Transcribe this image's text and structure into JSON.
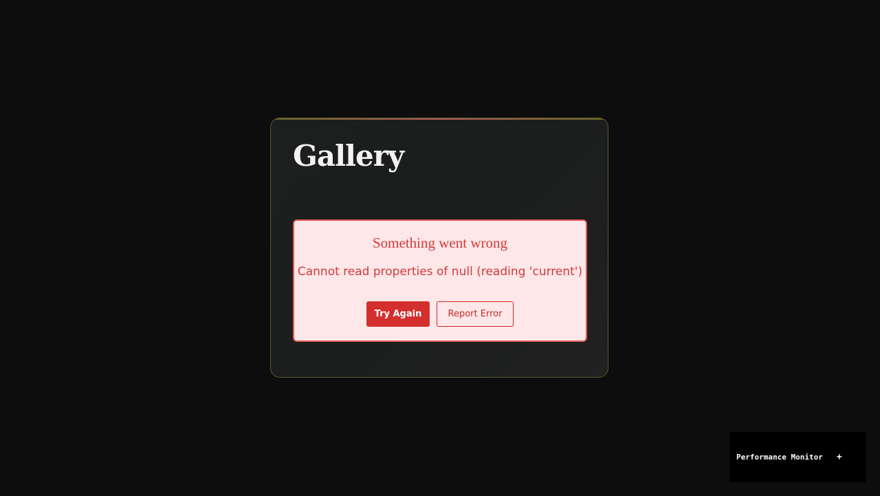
{
  "card": {
    "title": "Gallery"
  },
  "error": {
    "title": "Something went wrong",
    "message": "Cannot read properties of null (reading 'current')",
    "try_again_label": "Try Again",
    "report_label": "Report Error"
  },
  "perf_monitor": {
    "label": "Performance Monitor",
    "toggle": "+"
  },
  "colors": {
    "background": "#0d0d0d",
    "card_background": "#1d1f1f",
    "error_text": "#d1393b",
    "error_background": "#fde7e8",
    "primary_button": "#d32f2f"
  }
}
